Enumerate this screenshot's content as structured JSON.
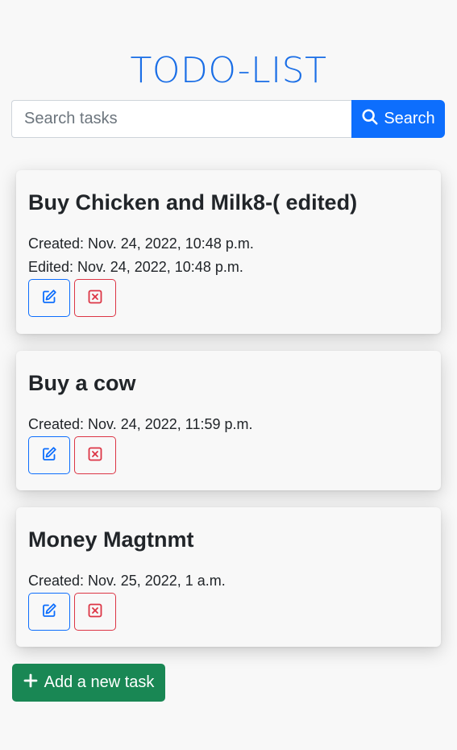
{
  "header": {
    "title": "TODO-LIST"
  },
  "search": {
    "placeholder": "Search tasks",
    "value": "",
    "button_label": "Search"
  },
  "tasks": [
    {
      "title": "Buy Chicken and Milk8-( edited)",
      "created": "Created: Nov. 24, 2022, 10:48 p.m.",
      "edited": "Edited: Nov. 24, 2022, 10:48 p.m."
    },
    {
      "title": "Buy a cow",
      "created": "Created: Nov. 24, 2022, 11:59 p.m."
    },
    {
      "title": "Money Magtnmt",
      "created": "Created: Nov. 25, 2022, 1 a.m."
    }
  ],
  "add_button": {
    "label": "Add a new task"
  },
  "colors": {
    "primary": "#0d6efd",
    "danger": "#dc3545",
    "success": "#198754",
    "title": "#1a6ee6",
    "background": "#f8f8f8"
  },
  "icons": {
    "search": "search-icon",
    "edit": "pencil-square-icon",
    "delete": "x-square-icon",
    "add": "plus-icon"
  }
}
